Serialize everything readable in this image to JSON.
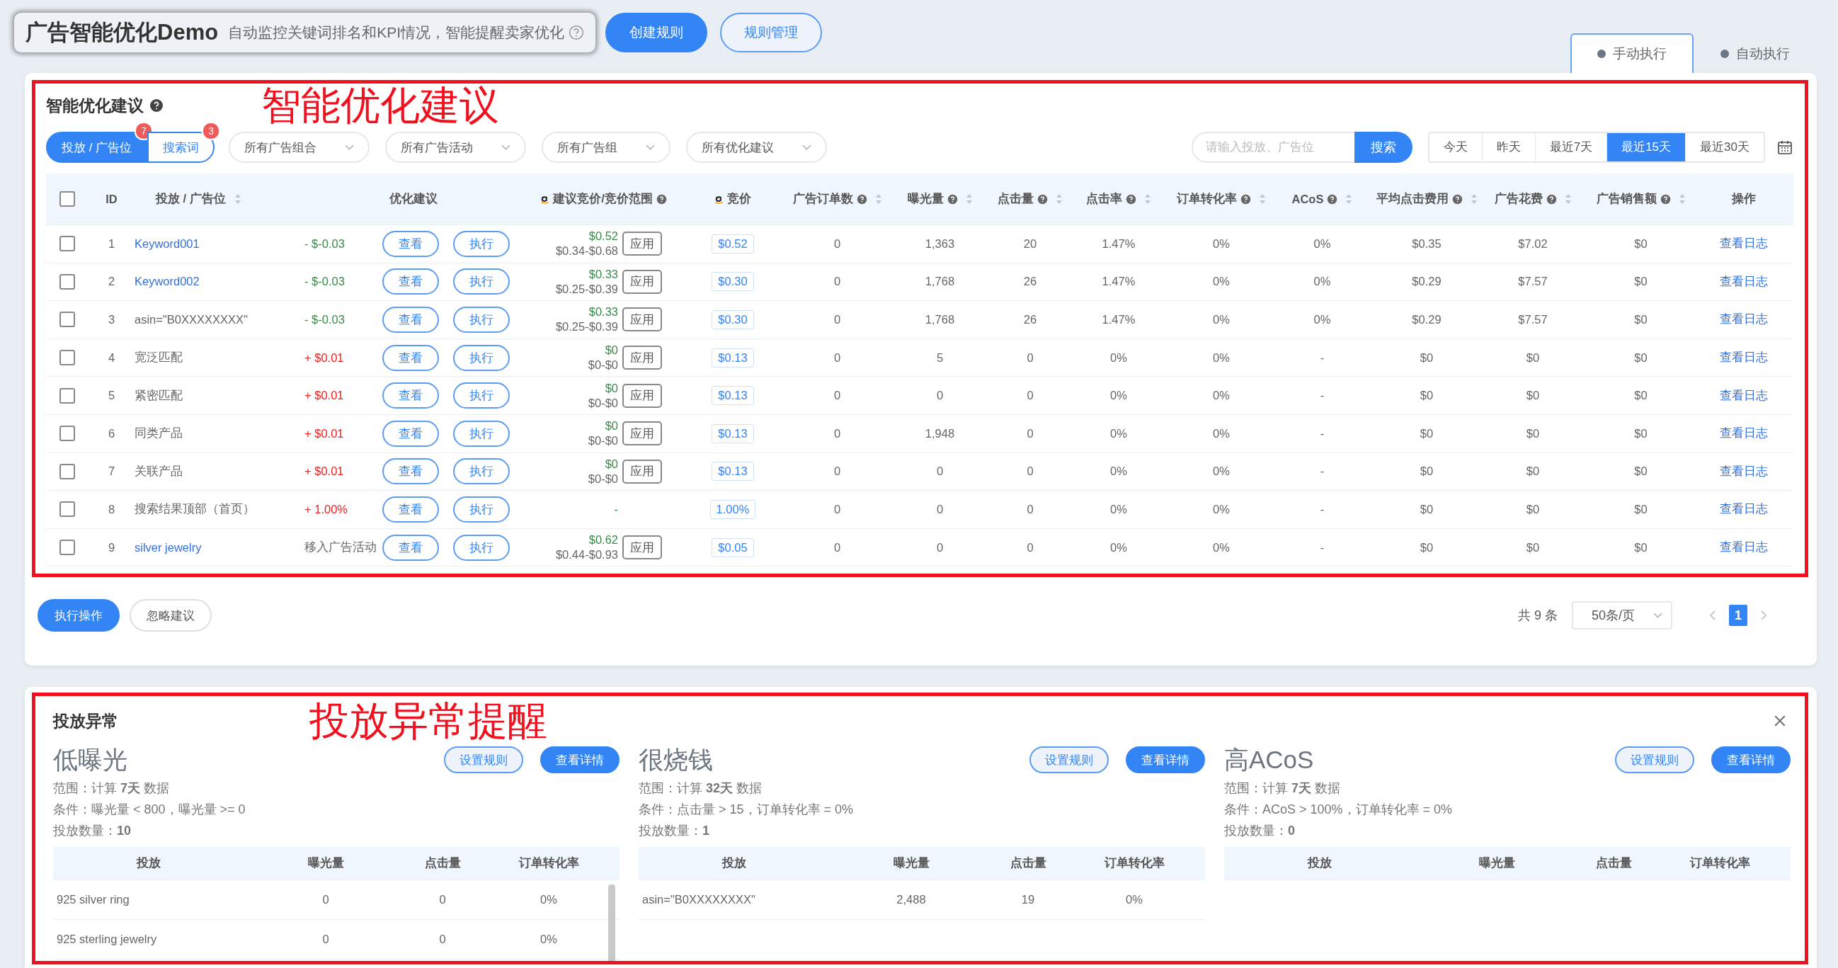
{
  "header": {
    "title": "广告智能优化Demo",
    "subtitle": "自动监控关键词排名和KPI情况，智能提醒卖家优化",
    "buttons": [
      {
        "label": "创建规则",
        "primary": true
      },
      {
        "label": "规则管理",
        "primary": false
      }
    ]
  },
  "mode_tabs": [
    {
      "label": "手动执行",
      "selected": true
    },
    {
      "label": "自动执行",
      "selected": false
    }
  ],
  "suggestions": {
    "title": "智能优化建议",
    "annotation": "智能优化建议",
    "type_tabs": [
      {
        "label": "投放 / 广告位",
        "badge": "7",
        "selected": true
      },
      {
        "label": "搜索词",
        "badge": "3",
        "selected": false
      }
    ],
    "filters": [
      "所有广告组合",
      "所有广告活动",
      "所有广告组",
      "所有优化建议"
    ],
    "search": {
      "placeholder": "请输入投放、广告位",
      "button": "搜索"
    },
    "date_ranges": [
      {
        "label": "今天",
        "selected": false
      },
      {
        "label": "昨天",
        "selected": false
      },
      {
        "label": "最近7天",
        "selected": false
      },
      {
        "label": "最近15天",
        "selected": true
      },
      {
        "label": "最近30天",
        "selected": false
      }
    ],
    "table": {
      "header_checked": false,
      "columns": [
        {
          "label": "ID"
        },
        {
          "label": "投放 / 广告位",
          "sortable": true
        },
        {
          "label": "优化建议"
        },
        {
          "label": "建议竞价/竞价范围",
          "help": true,
          "logo": true
        },
        {
          "label": "竞价",
          "logo": true
        },
        {
          "label": "广告订单数",
          "help": true,
          "sortable": true
        },
        {
          "label": "曝光量",
          "help": true,
          "sortable": true
        },
        {
          "label": "点击量",
          "help": true,
          "sortable": true
        },
        {
          "label": "点击率",
          "help": true,
          "sortable": true
        },
        {
          "label": "订单转化率",
          "help": true,
          "sortable": true
        },
        {
          "label": "ACoS",
          "help": true,
          "sortable": true
        },
        {
          "label": "平均点击费用",
          "help": true,
          "sortable": true
        },
        {
          "label": "广告花费",
          "help": true,
          "sortable": true
        },
        {
          "label": "广告销售额",
          "help": true,
          "sortable": true
        },
        {
          "label": "操作"
        }
      ],
      "rows": [
        {
          "checked": false,
          "id": "1",
          "target": "Keyword001",
          "link": true,
          "change": "- $-0.03",
          "color": "#3a8a4a",
          "view": "查看",
          "exec": "执行",
          "suggested": "$0.52",
          "range": "$0.34-$0.68",
          "apply": "应用",
          "bid": "$0.52",
          "orders": "0",
          "impressions": "1,363",
          "clicks": "20",
          "ctr": "1.47%",
          "cvr": "0%",
          "acos": "0%",
          "cpc": "$0.35",
          "spend": "$7.02",
          "sales": "$0",
          "action": "查看日志"
        },
        {
          "checked": false,
          "id": "2",
          "target": "Keyword002",
          "link": true,
          "change": "- $-0.03",
          "color": "#3a8a4a",
          "view": "查看",
          "exec": "执行",
          "suggested": "$0.33",
          "range": "$0.25-$0.39",
          "apply": "应用",
          "bid": "$0.30",
          "orders": "0",
          "impressions": "1,768",
          "clicks": "26",
          "ctr": "1.47%",
          "cvr": "0%",
          "acos": "0%",
          "cpc": "$0.29",
          "spend": "$7.57",
          "sales": "$0",
          "action": "查看日志"
        },
        {
          "checked": false,
          "id": "3",
          "target": "asin=\"B0XXXXXXXX\"",
          "link": false,
          "change": "- $-0.03",
          "color": "#3a8a4a",
          "view": "查看",
          "exec": "执行",
          "suggested": "$0.33",
          "range": "$0.25-$0.39",
          "apply": "应用",
          "bid": "$0.30",
          "orders": "0",
          "impressions": "1,768",
          "clicks": "26",
          "ctr": "1.47%",
          "cvr": "0%",
          "acos": "0%",
          "cpc": "$0.29",
          "spend": "$7.57",
          "sales": "$0",
          "action": "查看日志"
        },
        {
          "checked": false,
          "id": "4",
          "target": "宽泛匹配",
          "link": false,
          "change": "+ $0.01",
          "color": "#f02020",
          "view": "查看",
          "exec": "执行",
          "suggested": "$0",
          "range": "$0-$0",
          "apply": "应用",
          "bid": "$0.13",
          "orders": "0",
          "impressions": "5",
          "clicks": "0",
          "ctr": "0%",
          "cvr": "0%",
          "acos": "-",
          "cpc": "$0",
          "spend": "$0",
          "sales": "$0",
          "action": "查看日志"
        },
        {
          "checked": false,
          "id": "5",
          "target": "紧密匹配",
          "link": false,
          "change": "+ $0.01",
          "color": "#f02020",
          "view": "查看",
          "exec": "执行",
          "suggested": "$0",
          "range": "$0-$0",
          "apply": "应用",
          "bid": "$0.13",
          "orders": "0",
          "impressions": "0",
          "clicks": "0",
          "ctr": "0%",
          "cvr": "0%",
          "acos": "-",
          "cpc": "$0",
          "spend": "$0",
          "sales": "$0",
          "action": "查看日志"
        },
        {
          "checked": false,
          "id": "6",
          "target": "同类产品",
          "link": false,
          "change": "+ $0.01",
          "color": "#f02020",
          "view": "查看",
          "exec": "执行",
          "suggested": "$0",
          "range": "$0-$0",
          "apply": "应用",
          "bid": "$0.13",
          "orders": "0",
          "impressions": "1,948",
          "clicks": "0",
          "ctr": "0%",
          "cvr": "0%",
          "acos": "-",
          "cpc": "$0",
          "spend": "$0",
          "sales": "$0",
          "action": "查看日志"
        },
        {
          "checked": false,
          "id": "7",
          "target": "关联产品",
          "link": false,
          "change": "+ $0.01",
          "color": "#f02020",
          "view": "查看",
          "exec": "执行",
          "suggested": "$0",
          "range": "$0-$0",
          "apply": "应用",
          "bid": "$0.13",
          "orders": "0",
          "impressions": "0",
          "clicks": "0",
          "ctr": "0%",
          "cvr": "0%",
          "acos": "-",
          "cpc": "$0",
          "spend": "$0",
          "sales": "$0",
          "action": "查看日志"
        },
        {
          "checked": false,
          "id": "8",
          "target": "搜索结果顶部（首页）",
          "link": false,
          "change": "+ 1.00%",
          "color": "#f02020",
          "view": "查看",
          "exec": "执行",
          "suggested": "-",
          "bid": "1.00%",
          "orders": "0",
          "impressions": "0",
          "clicks": "0",
          "ctr": "0%",
          "cvr": "0%",
          "acos": "-",
          "cpc": "$0",
          "spend": "$0",
          "sales": "$0",
          "action": "查看日志"
        },
        {
          "checked": false,
          "id": "9",
          "target": "silver jewelry",
          "link": true,
          "change": "移入广告活动",
          "color": "#666666",
          "view": "查看",
          "exec": "执行",
          "suggested": "$0.62",
          "range": "$0.44-$0.93",
          "apply": "应用",
          "bid": "$0.05",
          "orders": "0",
          "impressions": "0",
          "clicks": "0",
          "ctr": "0%",
          "cvr": "0%",
          "acos": "-",
          "cpc": "$0",
          "spend": "$0",
          "sales": "$0",
          "action": "查看日志"
        }
      ]
    },
    "actions": [
      {
        "label": "执行操作",
        "primary": true
      },
      {
        "label": "忽略建议",
        "primary": false
      }
    ],
    "pagination": {
      "total": "共 9 条",
      "page_size": "50条/页",
      "pages": [
        {
          "label": "1",
          "selected": true
        }
      ]
    }
  },
  "anomalies": {
    "title": "投放异常",
    "annotation": "投放异常提醒",
    "panels": [
      {
        "title": "低曝光",
        "buttons": [
          {
            "label": "设置规则",
            "primary": false
          },
          {
            "label": "查看详情",
            "primary": true
          }
        ],
        "scope": "范围：计算 **7天** 数据",
        "condition": "条件：曝光量 < 800，曝光量 >= 0",
        "count": "投放数量：**10**",
        "columns": [
          "投放",
          "曝光量",
          "点击量",
          "订单转化率"
        ],
        "scrollable": true,
        "rows": [
          [
            "925 silver ring",
            "0",
            "0",
            "0%"
          ],
          [
            "925 sterling jewelry",
            "0",
            "0",
            "0%"
          ]
        ]
      },
      {
        "title": "很烧钱",
        "buttons": [
          {
            "label": "设置规则",
            "primary": false
          },
          {
            "label": "查看详情",
            "primary": true
          }
        ],
        "scope": "范围：计算 **32天** 数据",
        "condition": "条件：点击量 > 15，订单转化率 = 0%",
        "count": "投放数量：**1**",
        "columns": [
          "投放",
          "曝光量",
          "点击量",
          "订单转化率"
        ],
        "rows": [
          [
            "asin=\"B0XXXXXXXX\"",
            "2,488",
            "19",
            "0%"
          ]
        ]
      },
      {
        "title": "高ACoS",
        "buttons": [
          {
            "label": "设置规则",
            "primary": false
          },
          {
            "label": "查看详情",
            "primary": true
          }
        ],
        "scope": "范围：计算 **7天** 数据",
        "condition": "条件：ACoS > 100%，订单转化率 = 0%",
        "count": "投放数量：**0**",
        "columns": [
          "投放",
          "曝光量",
          "点击量",
          "订单转化率"
        ]
      }
    ]
  }
}
